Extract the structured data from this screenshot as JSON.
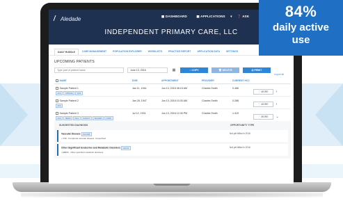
{
  "app": {
    "logo_text": "Aledade",
    "nav": [
      "DASHBOARD",
      "APPLICATIONS",
      "ASK"
    ],
    "practice_name": "INDEPENDENT PRIMARY CARE, LLC"
  },
  "tabs": [
    {
      "label": "DAILY HUDDLE",
      "active": true
    },
    {
      "label": "CARE MANAGEMENT",
      "active": false
    },
    {
      "label": "POPULATION EXPLORER",
      "active": false
    },
    {
      "label": "WORKLISTS",
      "active": false
    },
    {
      "label": "PRACTICE REPORT",
      "active": false
    },
    {
      "label": "APPLICATION DATA",
      "active": false
    },
    {
      "label": "SETTINGS",
      "active": false
    }
  ],
  "section_title": "UPCOMING PATIENTS",
  "filters": {
    "search_placeholder": "Type part of patient name",
    "date_value": "June 13, 2016",
    "copy_label": "COPY",
    "delete_label": "DELETE",
    "print_label": "PRINT",
    "export_label": "export all"
  },
  "table": {
    "headers": [
      "NAME",
      "DOB",
      "APPOINTMENT",
      "PROVIDER",
      "CURRENT HCC"
    ],
    "more_label": "MORE",
    "rows": [
      {
        "name": "Sample Patient 1",
        "dob": "Jan 11, 1944",
        "appointment": "Jun 13, 2016  08:15 AM",
        "provider": "Charles Smith",
        "hcc": "0.466",
        "chips": [
          "ACC",
          "STROKE",
          "CHS"
        ],
        "expanded": false
      },
      {
        "name": "Sample Patient 2",
        "dob": "Jan 28, 1947",
        "appointment": "Jun 13, 2016  10:30 AM",
        "provider": "Charles Smith",
        "hcc": "0.288",
        "chips": [
          "ACC"
        ],
        "expanded": false
      },
      {
        "name": "Sample Patient 3",
        "dob": "Jul 12, 1931",
        "appointment": "Jun 13, 2016  12:30 PM",
        "provider": "Charles Smith",
        "hcc": "1.419",
        "chips": [
          "ACC",
          "MEDS",
          "FALL",
          "SAFETY",
          "WALKER",
          "COPD"
        ],
        "expanded": true
      }
    ]
  },
  "suggested": {
    "col_diagnosis": "SUGGESTED DIAGNOSIS",
    "col_opportunity": "OPPORTUNITY TYPE",
    "items": [
      {
        "title": "Vascular Disease",
        "tag": "HCC108",
        "code": "I739 - Peripheral vascular disease, unspecified",
        "opportunity": "Not yet billed in 2016"
      },
      {
        "title": "Other Significant Endocrine and Metabolic Disorders",
        "tag": "HCC23",
        "code": "E8809 - Other specified metabolic disorders",
        "opportunity": "Not yet billed in 2016"
      }
    ]
  },
  "badge": {
    "percent": "84%",
    "line1": "daily active",
    "line2": "use",
    "color": "#1f6fc5"
  }
}
